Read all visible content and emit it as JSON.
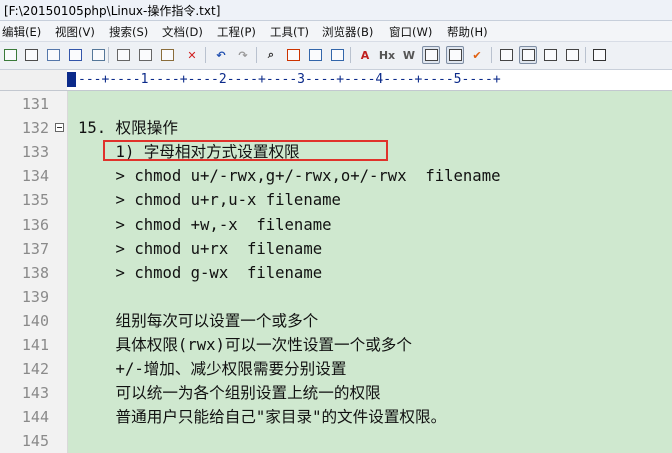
{
  "window": {
    "title": "[F:\\20150105php\\Linux-操作指令.txt]"
  },
  "menu": [
    {
      "label": "编辑(E)"
    },
    {
      "label": "视图(V)"
    },
    {
      "label": "搜索(S)"
    },
    {
      "label": "文档(D)"
    },
    {
      "label": "工程(P)"
    },
    {
      "label": "工具(T)"
    },
    {
      "label": "浏览器(B)"
    },
    {
      "label": "窗口(W)"
    },
    {
      "label": "帮助(H)"
    }
  ],
  "toolbar": {
    "icons": [
      {
        "name": "save-icon",
        "glyph": "",
        "color": "#3a7a3a"
      },
      {
        "name": "print-icon",
        "glyph": "",
        "color": "#4d4d4d"
      },
      {
        "name": "print-preview-icon",
        "glyph": "",
        "color": "#5577aa"
      },
      {
        "name": "spellcheck-icon",
        "glyph": "",
        "color": "#3355aa"
      },
      {
        "name": "page-setup-icon",
        "glyph": "",
        "color": "#557799"
      },
      {
        "name": "cut-icon",
        "glyph": "",
        "color": "#666"
      },
      {
        "name": "copy-icon",
        "glyph": "",
        "color": "#666"
      },
      {
        "name": "paste-icon",
        "glyph": "",
        "color": "#8a6d3b"
      },
      {
        "name": "delete-icon",
        "glyph": "✕",
        "color": "#d02020"
      },
      {
        "name": "undo-icon",
        "glyph": "↶",
        "color": "#1f4fb0"
      },
      {
        "name": "redo-icon",
        "glyph": "↷",
        "color": "#999"
      },
      {
        "name": "find-icon",
        "glyph": "⌕",
        "color": "#333"
      },
      {
        "name": "replace-icon",
        "glyph": "",
        "color": "#cc3300"
      },
      {
        "name": "goto-icon",
        "glyph": "",
        "color": "#3366aa"
      },
      {
        "name": "indent-icon",
        "glyph": "",
        "color": "#3366aa"
      },
      {
        "name": "font-icon",
        "glyph": "A",
        "color": "#c02020"
      },
      {
        "name": "hex-icon",
        "glyph": "Hx",
        "color": "#555"
      },
      {
        "name": "wordwrap-icon",
        "glyph": "W",
        "color": "#555"
      },
      {
        "name": "line-number-icon",
        "glyph": "",
        "color": "#444"
      },
      {
        "name": "column-mode-icon",
        "glyph": "",
        "color": "#444"
      },
      {
        "name": "checkmark-icon",
        "glyph": "✔",
        "color": "#e06010"
      },
      {
        "name": "panel-icon",
        "glyph": "",
        "color": "#444"
      },
      {
        "name": "split-view-icon",
        "glyph": "",
        "color": "#444"
      },
      {
        "name": "window-list-icon",
        "glyph": "",
        "color": "#444"
      },
      {
        "name": "output-window-icon",
        "glyph": "",
        "color": "#444"
      },
      {
        "name": "help-pointer-icon",
        "glyph": "",
        "color": "#333"
      }
    ]
  },
  "ruler": {
    "text": "---+----1----+----2----+----3----+----4----+----5----+"
  },
  "lines": [
    {
      "num": "131",
      "text": ""
    },
    {
      "num": "132",
      "text": "15. 权限操作",
      "fold": true
    },
    {
      "num": "133",
      "text": "    1) 字母相对方式设置权限"
    },
    {
      "num": "134",
      "text": "    > chmod u+/-rwx,g+/-rwx,o+/-rwx  filename"
    },
    {
      "num": "135",
      "text": "    > chmod u+r,u-x filename"
    },
    {
      "num": "136",
      "text": "    > chmod +w,-x  filename"
    },
    {
      "num": "137",
      "text": "    > chmod u+rx  filename"
    },
    {
      "num": "138",
      "text": "    > chmod g-wx  filename"
    },
    {
      "num": "139",
      "text": ""
    },
    {
      "num": "140",
      "text": "    组别每次可以设置一个或多个"
    },
    {
      "num": "141",
      "text": "    具体权限(rwx)可以一次性设置一个或多个"
    },
    {
      "num": "142",
      "text": "    +/-增加、减少权限需要分别设置"
    },
    {
      "num": "143",
      "text": "    可以统一为各个组别设置上统一的权限"
    },
    {
      "num": "144",
      "text": "    普通用户只能给自己\"家目录\"的文件设置权限。"
    },
    {
      "num": "145",
      "text": ""
    }
  ],
  "colors": {
    "editor_bg": "#cfe8cf",
    "gutter_bg": "#f2f2f2",
    "line_number": "#8a8a8a",
    "highlight_border": "#e0322b",
    "ruler_text": "#0b2a8a"
  }
}
